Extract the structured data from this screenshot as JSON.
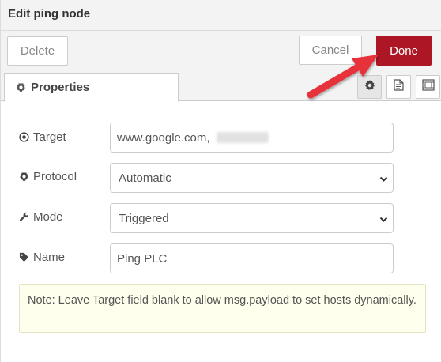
{
  "tray": {
    "title": "Edit ping node"
  },
  "toolbar": {
    "delete_label": "Delete",
    "cancel_label": "Cancel",
    "done_label": "Done"
  },
  "tabs": {
    "properties_label": "Properties",
    "icons": [
      "gear-icon",
      "description-icon",
      "appearance-icon"
    ]
  },
  "form": {
    "target": {
      "label": "Target",
      "value": "www.google.com,"
    },
    "protocol": {
      "label": "Protocol",
      "value": "Automatic"
    },
    "mode": {
      "label": "Mode",
      "value": "Triggered"
    },
    "name": {
      "label": "Name",
      "value": "Ping PLC"
    }
  },
  "note": {
    "text": "Note: Leave Target field blank to allow msg.payload to set hosts dynamically."
  },
  "colors": {
    "done_button": "#ad1625",
    "annotation_arrow": "#e8333a",
    "note_background": "#ffffee"
  }
}
